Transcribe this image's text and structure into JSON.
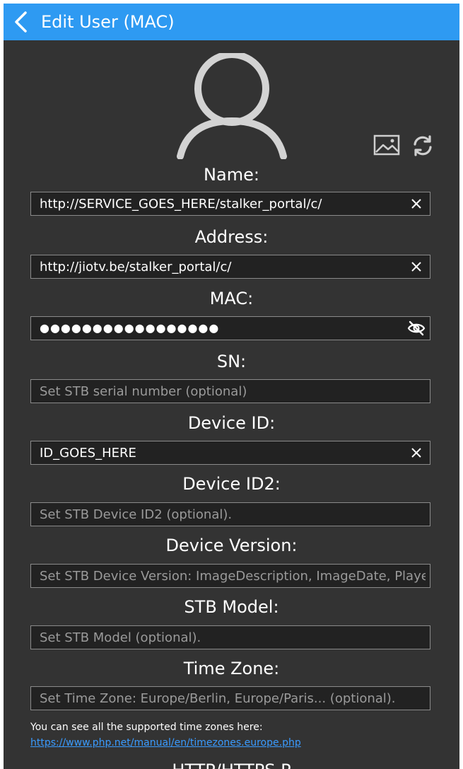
{
  "header": {
    "title": "Edit User (MAC)",
    "background": "#2e9af2"
  },
  "fields": {
    "name": {
      "label": "Name:",
      "value": "http://SERVICE_GOES_HERE/stalker_portal/c/",
      "placeholder": ""
    },
    "address": {
      "label": "Address:",
      "value": "http://jiotv.be/stalker_portal/c/",
      "placeholder": ""
    },
    "mac": {
      "label": "MAC:",
      "masked_value": "●●●●●●●●●●●●●●●●●"
    },
    "sn": {
      "label": "SN:",
      "value": "",
      "placeholder": "Set STB serial number (optional)"
    },
    "device_id": {
      "label": "Device ID:",
      "value": "ID_GOES_HERE",
      "placeholder": ""
    },
    "device_id2": {
      "label": "Device ID2:",
      "value": "",
      "placeholder": "Set STB Device ID2 (optional)."
    },
    "device_version": {
      "label": "Device Version:",
      "value": "",
      "placeholder": "Set STB Device Version: ImageDescription, ImageDate, PlayerEngineVersion..."
    },
    "stb_model": {
      "label": "STB Model:",
      "value": "",
      "placeholder": "Set STB Model (optional)."
    },
    "time_zone": {
      "label": "Time Zone:",
      "value": "",
      "placeholder": "Set Time Zone: Europe/Berlin, Europe/Paris... (optional)."
    }
  },
  "hint": {
    "text": "You can see all the supported time zones here:",
    "link": "https://www.php.net/manual/en/timezones.europe.php"
  },
  "next_section_label": "HTTP/HTTPS P",
  "icons": {
    "back": "chevron-left-icon",
    "avatar": "user-avatar-icon",
    "image": "image-icon",
    "refresh": "refresh-icon",
    "clear": "close-icon",
    "visibility": "eye-off-icon"
  }
}
